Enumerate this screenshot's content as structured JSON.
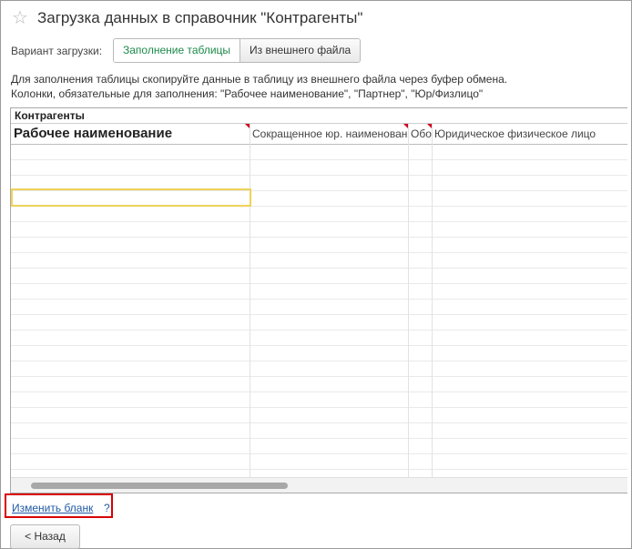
{
  "window": {
    "title": "Загрузка данных в справочник \"Контрагенты\"",
    "favorite_icon": "star-outline-icon"
  },
  "load_variant": {
    "label": "Вариант загрузки:",
    "options": [
      {
        "label": "Заполнение таблицы",
        "selected": true
      },
      {
        "label": "Из внешнего файла",
        "selected": false
      }
    ]
  },
  "instructions": {
    "line1": "Для заполнения таблицы скопируйте данные в таблицу из внешнего файла через буфер обмена.",
    "line2": "Колонки, обязательные для заполнения: \"Рабочее наименование\", \"Партнер\", \"Юр/Физлицо\""
  },
  "table": {
    "caption": "Контрагенты",
    "columns": [
      {
        "label": "Рабочее наименование",
        "required": true
      },
      {
        "label": "Сокращенное юр. наименование",
        "required": true
      },
      {
        "label": "Обособленное подразделение",
        "required": true
      },
      {
        "label": "Юридическое физическое лицо",
        "required": false
      }
    ],
    "rows": []
  },
  "footer": {
    "edit_link": "Изменить бланк",
    "help": "?",
    "back_button": "< Назад"
  },
  "colors": {
    "accent_green": "#1c8a4a",
    "link_blue": "#215aa5",
    "highlight_red": "#d80000",
    "required_marker": "#d0021b",
    "cell_cursor": "#efd25a"
  }
}
